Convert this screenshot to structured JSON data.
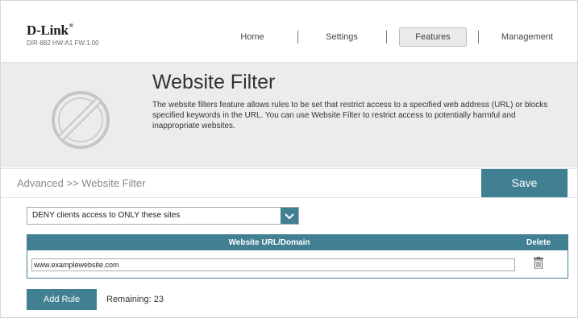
{
  "brand": {
    "logo": "D-Link",
    "model": "DIR-882 HW:A1 FW:1.00"
  },
  "nav": {
    "home": "Home",
    "settings": "Settings",
    "features": "Features",
    "management": "Management",
    "active": "Features"
  },
  "hero": {
    "title": "Website Filter",
    "description": "The website filters feature allows rules to be set that restrict access to a specified web address (URL) or blocks specified keywords in the URL. You can use Website Filter to restrict access to potentially harmful and inappropriate websites.",
    "icon": "prohibited-icon"
  },
  "breadcrumb": "Advanced >> Website Filter",
  "save_label": "Save",
  "filter_mode": {
    "selected": "DENY clients access to ONLY these sites",
    "icon": "chevron-down-icon"
  },
  "table": {
    "headers": {
      "url": "Website URL/Domain",
      "delete": "Delete"
    },
    "rows": [
      {
        "url": "www.examplewebsite.com",
        "delete_icon": "trash-icon"
      }
    ]
  },
  "add_rule_label": "Add Rule",
  "remaining_label": "Remaining:",
  "remaining_count": "23",
  "colors": {
    "accent": "#417f93",
    "hero_bg": "#ececee"
  }
}
